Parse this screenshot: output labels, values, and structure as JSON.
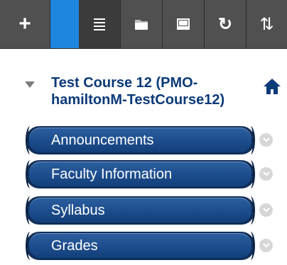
{
  "toolbar": {
    "buttons": [
      {
        "icon": "plus-icon"
      },
      {
        "icon": "accent-tab"
      },
      {
        "icon": "list-icon"
      },
      {
        "icon": "folder-icon"
      },
      {
        "icon": "window-icon"
      },
      {
        "icon": "refresh-icon"
      },
      {
        "icon": "sort-icon"
      }
    ],
    "plus_glyph": "+",
    "refresh_glyph": "↻",
    "sort_glyph": "⇅",
    "colors": {
      "background": "#505050",
      "accent": "#1f86e0",
      "selected": "#3b3b3b"
    }
  },
  "course": {
    "title": "Test Course 12 (PMO-hamiltonM-TestCourse12)",
    "expanded": true,
    "home_icon": "home-icon",
    "title_color": "#0b3a78"
  },
  "menu": {
    "items": [
      {
        "label": "Announcements"
      },
      {
        "label": "Faculty Information"
      },
      {
        "label": "Syllabus"
      },
      {
        "label": "Grades"
      }
    ],
    "item_color": "#1d4d8d",
    "chevron_icon": "chevron-down-icon"
  }
}
